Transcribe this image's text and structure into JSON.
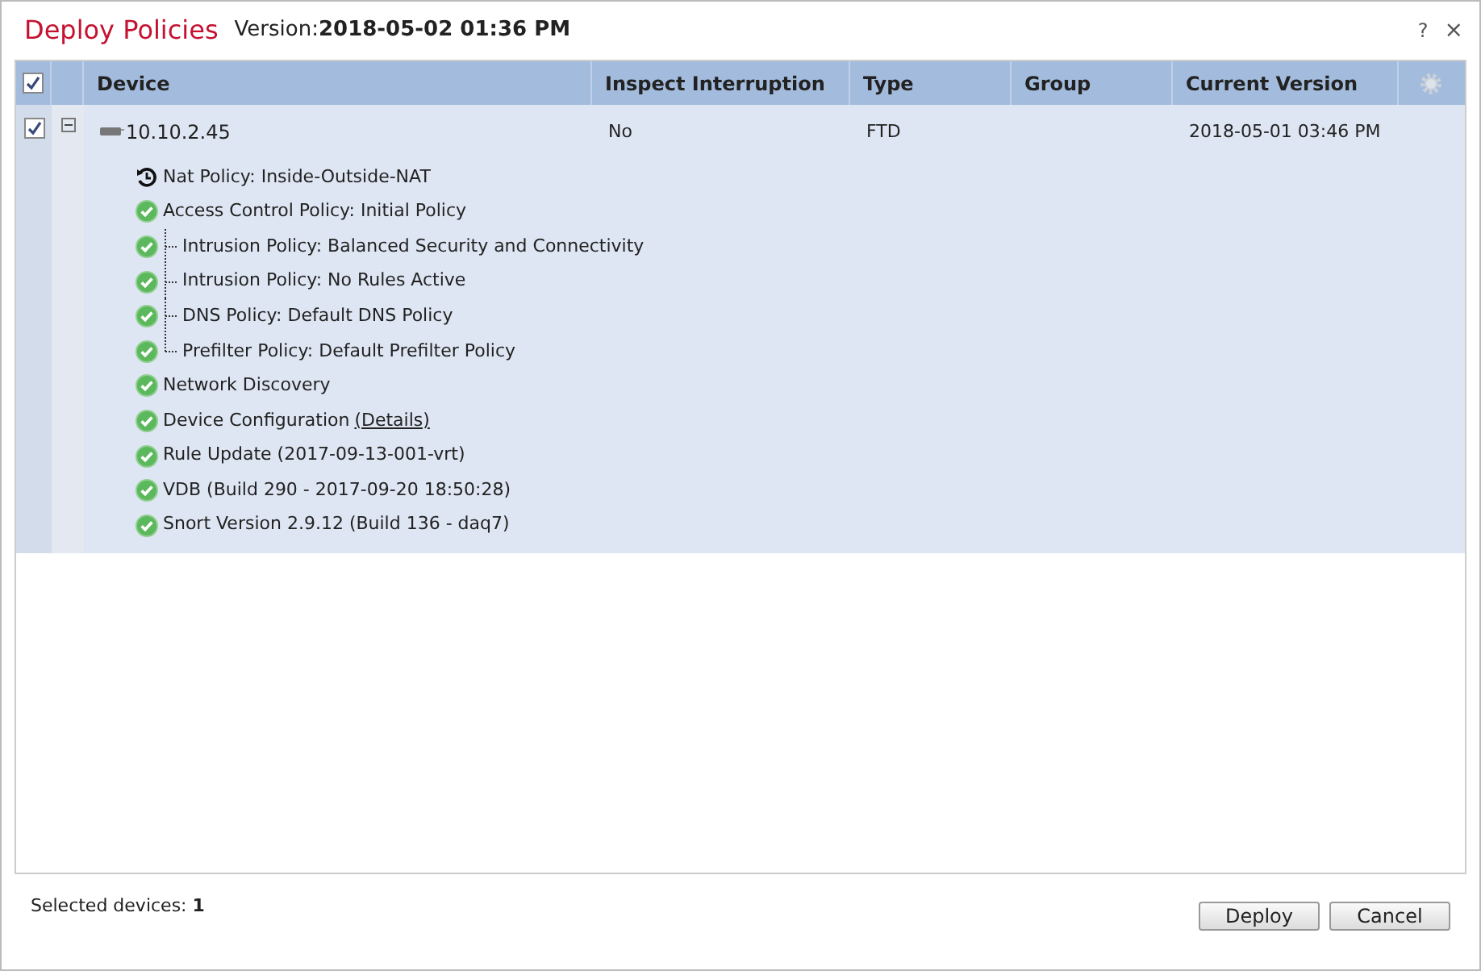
{
  "dialog": {
    "title": "Deploy Policies",
    "version_label": "Version:",
    "version": "2018-05-02 01:36 PM",
    "help": "?",
    "close": "×"
  },
  "table": {
    "select_all": {
      "checked": true
    },
    "columns": [
      "Device",
      "Inspect Interruption",
      "Type",
      "Group",
      "Current Version"
    ],
    "rows": [
      {
        "checked": true,
        "expanded": true,
        "device": "10.10.2.45",
        "inspect_interruption": "No",
        "type": "FTD",
        "group": "",
        "current_version": "2018-05-01 03:46 PM",
        "items": [
          {
            "kind": "history",
            "label": "Nat Policy: Inside-Outside-NAT"
          },
          {
            "kind": "ok",
            "label": "Access Control Policy: Initial Policy",
            "children": [
              {
                "kind": "ok",
                "label": "Intrusion Policy: Balanced Security and Connectivity"
              },
              {
                "kind": "ok",
                "label": "Intrusion Policy: No Rules Active"
              },
              {
                "kind": "ok",
                "label": "DNS Policy: Default DNS Policy"
              },
              {
                "kind": "ok",
                "label": "Prefilter Policy: Default Prefilter Policy"
              }
            ]
          },
          {
            "kind": "ok",
            "label": "Network Discovery"
          },
          {
            "kind": "ok",
            "label": "Device Configuration",
            "link": "(Details)"
          },
          {
            "kind": "ok",
            "label": "Rule Update (2017-09-13-001-vrt)"
          },
          {
            "kind": "ok",
            "label": "VDB (Build 290 - 2017-09-20 18:50:28)"
          },
          {
            "kind": "ok",
            "label": "Snort Version 2.9.12 (Build 136 - daq7)"
          }
        ]
      }
    ]
  },
  "footer": {
    "selected_label": "Selected devices:",
    "selected_count": "1",
    "buttons": [
      "Deploy",
      "Cancel"
    ]
  }
}
